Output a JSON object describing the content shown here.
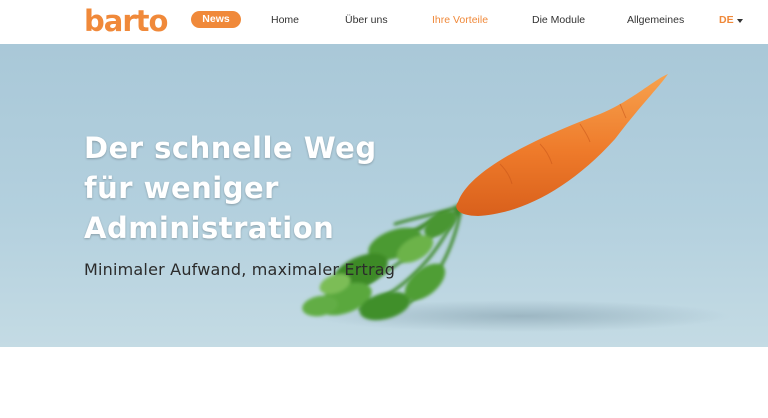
{
  "brand": {
    "logo_text": "barto",
    "color": "#f0893a"
  },
  "nav": {
    "news": "News",
    "items": [
      {
        "label": "Home"
      },
      {
        "label": "Über uns"
      },
      {
        "label": "Ihre Vorteile"
      },
      {
        "label": "Die Module"
      },
      {
        "label": "Allgemeines"
      }
    ],
    "active_index": 2,
    "language": "DE"
  },
  "hero": {
    "title_lines": [
      "Der schnelle Weg",
      "für weniger",
      "Administration"
    ],
    "subtitle": "Minimaler Aufwand, maximaler Ertrag",
    "image": "carrot-image"
  }
}
